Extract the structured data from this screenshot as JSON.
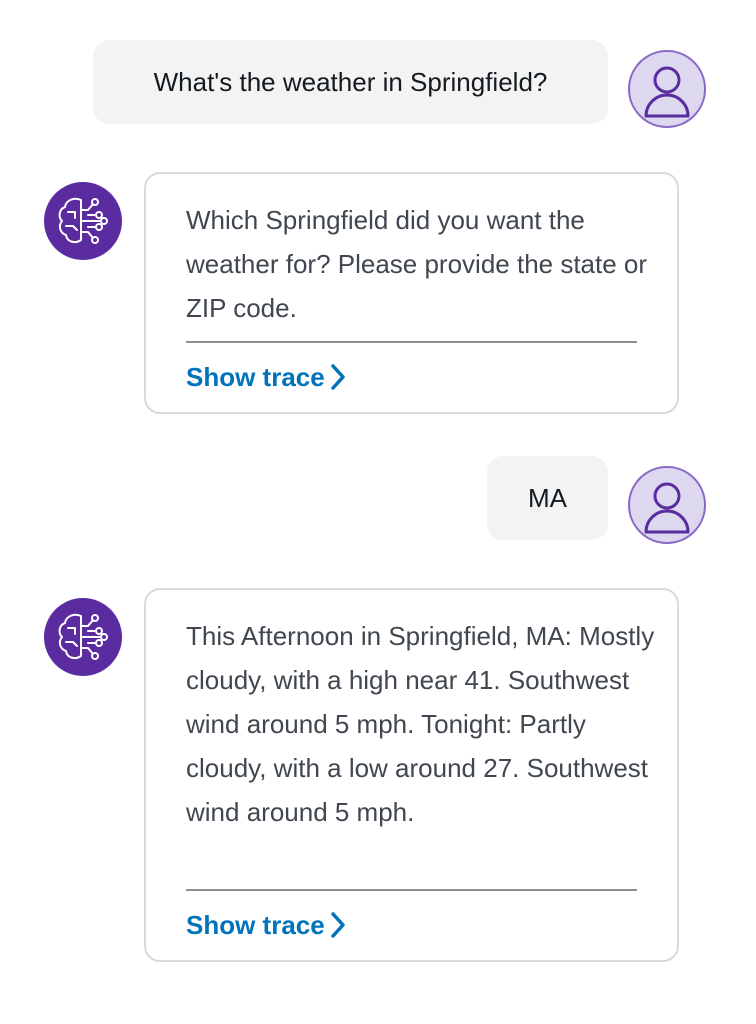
{
  "conversation": {
    "messages": [
      {
        "role": "user",
        "text": "What's the weather in Springfield?"
      },
      {
        "role": "assistant",
        "text": "Which Springfield did you want the weather for? Please provide the state or ZIP code.",
        "trace_label": "Show trace"
      },
      {
        "role": "user",
        "text": "MA"
      },
      {
        "role": "assistant",
        "text": "This Afternoon in Springfield, MA: Mostly cloudy, with a high near 41. Southwest wind around 5 mph. Tonight: Partly cloudy, with a low around 27. Southwest wind around 5 mph.",
        "trace_label": "Show trace"
      }
    ]
  },
  "icons": {
    "user_avatar": "user-avatar-icon",
    "bot_avatar": "brain-circuit-icon",
    "trace_chevron": "chevron-right-icon"
  },
  "colors": {
    "link": "#0073bb",
    "bot_avatar_bg": "#5a2ca0",
    "user_avatar_bg": "#ddd7ef",
    "user_bubble_bg": "#f2f3f3"
  }
}
